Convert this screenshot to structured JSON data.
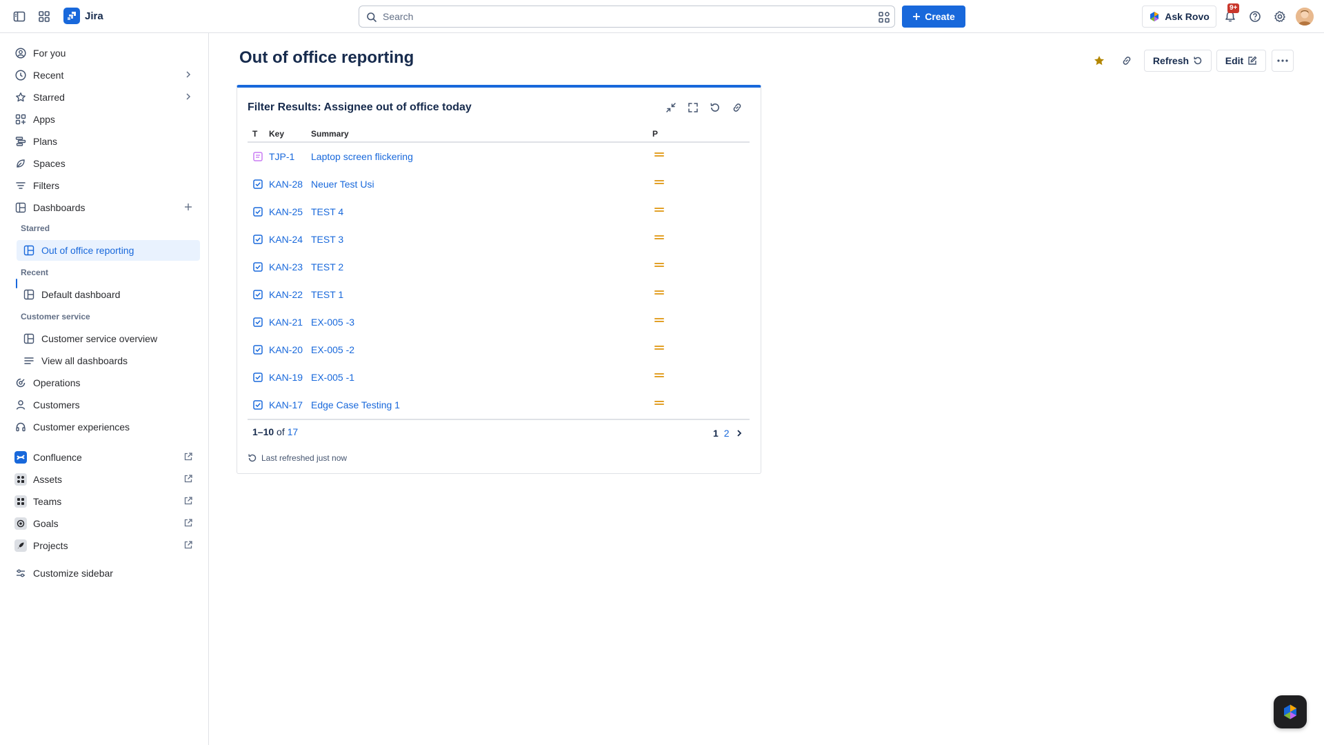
{
  "app": {
    "name": "Jira"
  },
  "topbar": {
    "search_placeholder": "Search",
    "create_label": "Create",
    "rovo_label": "Ask Rovo",
    "notifications_badge": "9+"
  },
  "sidebar": {
    "items_top": [
      {
        "label": "For you",
        "icon": "person-circle-icon"
      },
      {
        "label": "Recent",
        "icon": "clock-icon"
      },
      {
        "label": "Starred",
        "icon": "star-icon"
      },
      {
        "label": "Apps",
        "icon": "apps-icon"
      },
      {
        "label": "Plans",
        "icon": "plans-icon"
      },
      {
        "label": "Spaces",
        "icon": "spaces-icon"
      },
      {
        "label": "Filters",
        "icon": "filter-icon"
      },
      {
        "label": "Dashboards",
        "icon": "dashboard-icon"
      }
    ],
    "dashboards": {
      "starred_label": "Starred",
      "starred_item": "Out of office reporting",
      "recent_label": "Recent",
      "recent_item": "Default dashboard",
      "customer_service_label": "Customer service",
      "customer_service_item": "Customer service overview",
      "view_all": "View all dashboards"
    },
    "items_bottom": [
      {
        "label": "Operations"
      },
      {
        "label": "Customers"
      },
      {
        "label": "Customer experiences"
      }
    ],
    "apps": [
      {
        "label": "Confluence",
        "color": "#1868db"
      },
      {
        "label": "Assets",
        "color": "#ffffff"
      },
      {
        "label": "Teams",
        "color": "#ffffff"
      },
      {
        "label": "Goals",
        "color": "#ffffff"
      },
      {
        "label": "Projects",
        "color": "#ffffff"
      }
    ],
    "customize": "Customize sidebar"
  },
  "page": {
    "title": "Out of office reporting",
    "refresh_label": "Refresh",
    "edit_label": "Edit"
  },
  "gadget": {
    "title": "Filter Results: Assignee out of office today",
    "columns": {
      "type": "T",
      "key": "Key",
      "summary": "Summary",
      "priority": "P"
    },
    "rows": [
      {
        "key": "TJP-1",
        "summary": "Laptop screen flickering",
        "type": "request"
      },
      {
        "key": "KAN-28",
        "summary": "Neuer Test Usi",
        "type": "task"
      },
      {
        "key": "KAN-25",
        "summary": "TEST 4",
        "type": "task"
      },
      {
        "key": "KAN-24",
        "summary": "TEST 3",
        "type": "task"
      },
      {
        "key": "KAN-23",
        "summary": "TEST 2",
        "type": "task"
      },
      {
        "key": "KAN-22",
        "summary": "TEST 1",
        "type": "task"
      },
      {
        "key": "KAN-21",
        "summary": "EX-005 -3",
        "type": "task"
      },
      {
        "key": "KAN-20",
        "summary": "EX-005 -2",
        "type": "task"
      },
      {
        "key": "KAN-19",
        "summary": "EX-005 -1",
        "type": "task"
      },
      {
        "key": "KAN-17",
        "summary": "Edge Case Testing 1",
        "type": "task"
      }
    ],
    "count_range": "1–10",
    "count_of": "of",
    "count_total": "17",
    "pages": [
      "1",
      "2"
    ],
    "last_refreshed": "Last refreshed just now"
  },
  "colors": {
    "brand": "#1868db",
    "priority_medium": "#e2a027",
    "star": "#b38600",
    "request_type": "#c97cf4"
  }
}
